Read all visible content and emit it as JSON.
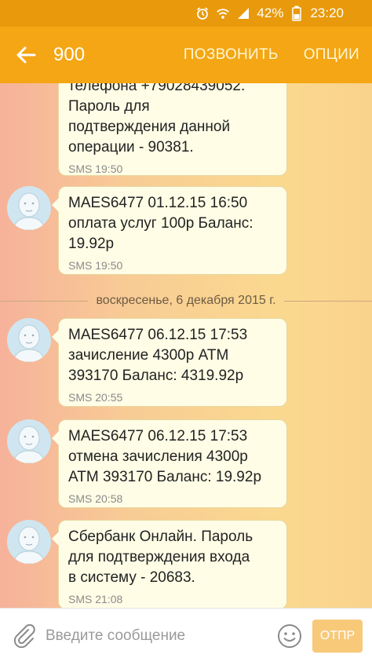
{
  "status_bar": {
    "battery_percent": "42%",
    "time": "23:20"
  },
  "header": {
    "title": "900",
    "call_label": "ПОЗВОНИТЬ",
    "options_label": "ОПЦИИ"
  },
  "thread": {
    "date_separator": "воскресенье, 6 декабря 2015 г.",
    "messages": [
      {
        "text": "телефона +79028439052.\nПароль для\nподтверждения данной\nоперации - 90381.",
        "time": "SMS 19:50"
      },
      {
        "text": "MAES6477 01.12.15 16:50\nоплата услуг 100р Баланс:\n19.92р",
        "time": "SMS 19:50"
      },
      {
        "text": "MAES6477 06.12.15 17:53\nзачисление 4300р ATM\n393170 Баланс: 4319.92р",
        "time": "SMS 20:55"
      },
      {
        "text": "MAES6477 06.12.15 17:53\nотмена зачисления 4300р\nATM 393170 Баланс: 19.92р",
        "time": "SMS 20:58"
      },
      {
        "text": "Сбербанк Онлайн. Пароль\nдля подтверждения входа\nв систему - 20683.",
        "time": "SMS 21:08"
      }
    ]
  },
  "composer": {
    "placeholder": "Введите сообщение",
    "send_label": "ОТПР"
  },
  "colors": {
    "appbar": "#f4a614",
    "statusbar": "#e89a0c",
    "bubble": "#fffde6",
    "background_left": "#f6b29a",
    "background_right": "#f9d28c"
  }
}
